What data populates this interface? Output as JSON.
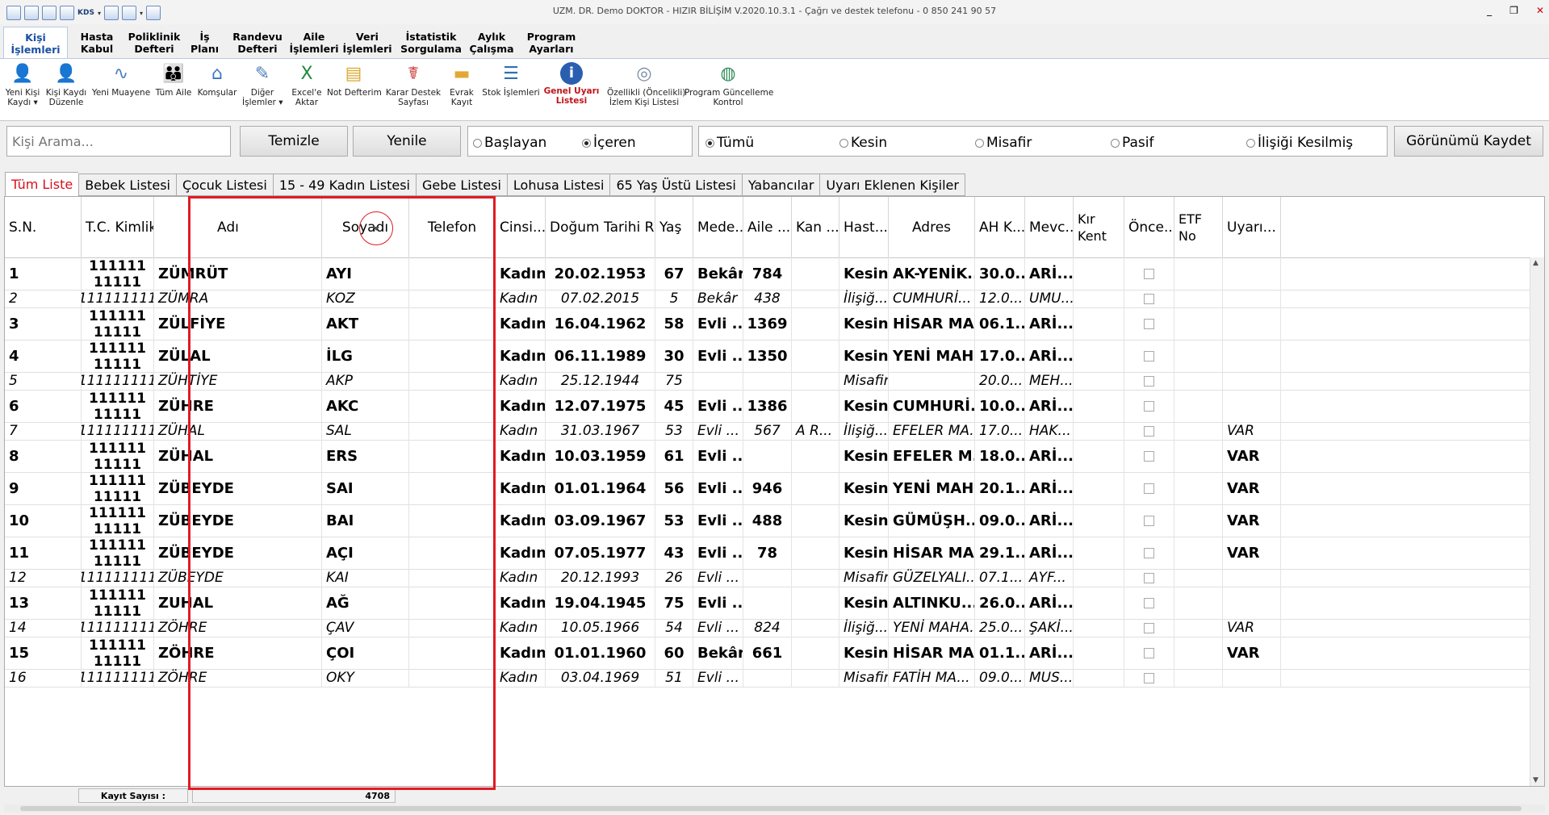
{
  "window": {
    "title": "UZM. DR. Demo DOKTOR - HIZIR BİLİŞİM V.2020.10.3.1 - Çağrı ve destek telefonu - 0 850 241 90 57",
    "quick_access_kds": "KDS",
    "minimize": "_",
    "restore": "❐",
    "close": "✕"
  },
  "ribbon_tabs": [
    "Kişi\nİşlemleri",
    "Hasta\nKabul",
    "Poliklinik\nDefteri",
    "İş\nPlanı",
    "Randevu\nDefteri",
    "Aile\nİşlemleri",
    "Veri\nİşlemleri",
    "İstatistik\nSorgulama",
    "Aylık\nÇalışma",
    "Program\nAyarları"
  ],
  "ribbon_buttons": [
    {
      "label": "Yeni Kişi\nKaydı ▾",
      "icon": "add-person-icon",
      "glyph": "👤",
      "color": "#4a8fd6"
    },
    {
      "label": "Kişi Kaydı\nDüzenle",
      "icon": "edit-person-icon",
      "glyph": "👤",
      "color": "#3d7fc9"
    },
    {
      "label": "Yeni Muayene",
      "icon": "stethoscope-icon",
      "glyph": "∿",
      "color": "#4a7fc0"
    },
    {
      "label": "Tüm Aile",
      "icon": "family-icon",
      "glyph": "👪",
      "color": "#d89b2a"
    },
    {
      "label": "Komşular",
      "icon": "house-icon",
      "glyph": "⌂",
      "color": "#3a76c4"
    },
    {
      "label": "Diğer\nİşlemler ▾",
      "icon": "other-actions-icon",
      "glyph": "✎",
      "color": "#4d7fb8"
    },
    {
      "label": "Excel'e\nAktar",
      "icon": "excel-icon",
      "glyph": "X",
      "color": "#1f8a3f"
    },
    {
      "label": "Not Defterim",
      "icon": "notepad-icon",
      "glyph": "▤",
      "color": "#d9a92f"
    },
    {
      "label": "Karar Destek\nSayfası",
      "icon": "decision-support-icon",
      "glyph": "☤",
      "color": "#c93838"
    },
    {
      "label": "Evrak\nKayıt",
      "icon": "folder-icon",
      "glyph": "▬",
      "color": "#e3a834"
    },
    {
      "label": "Stok İşlemleri",
      "icon": "stock-list-icon",
      "glyph": "☰",
      "color": "#2e6fb8"
    },
    {
      "label": "Genel Uyarı\nListesi",
      "icon": "info-icon",
      "glyph": "i",
      "color": "#2a5fb0"
    },
    {
      "label": "Özellikli (Öncelikli)\nİzlem Kişi Listesi",
      "icon": "priority-list-icon",
      "glyph": "◎",
      "color": "#7a8aa0"
    },
    {
      "label": "Program Güncelleme\nKontrol",
      "icon": "update-globe-icon",
      "glyph": "◍",
      "color": "#2e8b57"
    }
  ],
  "search": {
    "placeholder": "Kişi Arama..."
  },
  "buttons": {
    "clear": "Temizle",
    "refresh": "Yenile",
    "save_view": "Görünümü Kaydet"
  },
  "match_mode": {
    "starts": "Başlayan",
    "contains": "İçeren",
    "selected": "contains"
  },
  "status_filter": {
    "all": "Tümü",
    "definite": "Kesin",
    "guest": "Misafir",
    "passive": "Pasif",
    "detached": "İlişiği Kesilmiş",
    "selected": "all"
  },
  "list_tabs": [
    "Tüm Liste",
    "Bebek Listesi",
    "Çocuk Listesi",
    "15 - 49 Kadın Listesi",
    "Gebe Listesi",
    "Lohusa Listesi",
    "65 Yaş Üstü Listesi",
    "Yabancılar",
    "Uyarı Eklenen Kişiler"
  ],
  "columns": [
    "S.N.",
    "T.C. Kimlik No",
    "Adı",
    "Soyadı",
    "Telefon",
    "Cinsi...",
    "Doğum Tarihi R...",
    "Yaş",
    "Mede...",
    "Aile ...",
    "Kan ...",
    "Hast...",
    "Adres",
    "AH K...",
    "Mevc...",
    "Kır\nKent",
    "Önce...",
    "ETF\nNo",
    "Uyarı..."
  ],
  "rows": [
    {
      "sn": "1",
      "tc": "11111111111",
      "adi": "ZÜMRÜT",
      "soyadi": "AYI",
      "tel": "",
      "cins": "Kadın",
      "dogum": "20.02.1953",
      "yas": "67",
      "medeni": "Bekâr",
      "aile": "784",
      "kan": "",
      "hasta": "Kesin",
      "adres": "AK-YENİK...",
      "ah": "30.0...",
      "mevcut": "ARİ...",
      "uyari": "",
      "style": "b"
    },
    {
      "sn": "2",
      "tc": "11111111111",
      "adi": "ZÜMRA",
      "soyadi": "KOZ",
      "tel": "",
      "cins": "Kadın",
      "dogum": "07.02.2015",
      "yas": "5",
      "medeni": "Bekâr",
      "aile": "438",
      "kan": "",
      "hasta": "İlişiğ...",
      "adres": "CUMHURİ...",
      "ah": "12.0...",
      "mevcut": "UMU...",
      "uyari": "",
      "style": "i"
    },
    {
      "sn": "3",
      "tc": "11111111111",
      "adi": "ZÜLFİYE",
      "soyadi": "AKT",
      "tel": "",
      "cins": "Kadın",
      "dogum": "16.04.1962",
      "yas": "58",
      "medeni": "Evli ...",
      "aile": "1369",
      "kan": "",
      "hasta": "Kesin",
      "adres": "HİSAR MA...",
      "ah": "06.1...",
      "mevcut": "ARİ...",
      "uyari": "",
      "style": "b"
    },
    {
      "sn": "4",
      "tc": "11111111111",
      "adi": "ZÜLAL",
      "soyadi": "İLG",
      "tel": "",
      "cins": "Kadın",
      "dogum": "06.11.1989",
      "yas": "30",
      "medeni": "Evli ...",
      "aile": "1350",
      "kan": "",
      "hasta": "Kesin",
      "adres": "YENİ MAH...",
      "ah": "17.0...",
      "mevcut": "ARİ...",
      "uyari": "",
      "style": "b"
    },
    {
      "sn": "5",
      "tc": "11111111111",
      "adi": "ZÜHTİYE",
      "soyadi": "AKP",
      "tel": "",
      "cins": "Kadın",
      "dogum": "25.12.1944",
      "yas": "75",
      "medeni": "",
      "aile": "",
      "kan": "",
      "hasta": "Misafir",
      "adres": "",
      "ah": "20.0...",
      "mevcut": "MEH...",
      "uyari": "",
      "style": "i"
    },
    {
      "sn": "6",
      "tc": "11111111111",
      "adi": "ZÜHRE",
      "soyadi": "AKC",
      "tel": "",
      "cins": "Kadın",
      "dogum": "12.07.1975",
      "yas": "45",
      "medeni": "Evli ...",
      "aile": "1386",
      "kan": "",
      "hasta": "Kesin",
      "adres": "CUMHURİ...",
      "ah": "10.0...",
      "mevcut": "ARİ...",
      "uyari": "",
      "style": "b"
    },
    {
      "sn": "7",
      "tc": "11111111111",
      "adi": "ZÜHAL",
      "soyadi": "SAL",
      "tel": "",
      "cins": "Kadın",
      "dogum": "31.03.1967",
      "yas": "53",
      "medeni": "Evli ...",
      "aile": "567",
      "kan": "A R...",
      "hasta": "İlişiğ...",
      "adres": "EFELER MA...",
      "ah": "17.0...",
      "mevcut": "HAK...",
      "uyari": "VAR",
      "style": "i"
    },
    {
      "sn": "8",
      "tc": "11111111111",
      "adi": "ZÜHAL",
      "soyadi": "ERS",
      "tel": "",
      "cins": "Kadın",
      "dogum": "10.03.1959",
      "yas": "61",
      "medeni": "Evli ...",
      "aile": "",
      "kan": "",
      "hasta": "Kesin",
      "adres": "EFELER M...",
      "ah": "18.0...",
      "mevcut": "ARİ...",
      "uyari": "VAR",
      "style": "b"
    },
    {
      "sn": "9",
      "tc": "11111111111",
      "adi": "ZÜBEYDE",
      "soyadi": "SAI",
      "tel": "",
      "cins": "Kadın",
      "dogum": "01.01.1964",
      "yas": "56",
      "medeni": "Evli ...",
      "aile": "946",
      "kan": "",
      "hasta": "Kesin",
      "adres": "YENİ MAH...",
      "ah": "20.1...",
      "mevcut": "ARİ...",
      "uyari": "VAR",
      "style": "b"
    },
    {
      "sn": "10",
      "tc": "11111111111",
      "adi": "ZÜBEYDE",
      "soyadi": "BAI",
      "tel": "",
      "cins": "Kadın",
      "dogum": "03.09.1967",
      "yas": "53",
      "medeni": "Evli ...",
      "aile": "488",
      "kan": "",
      "hasta": "Kesin",
      "adres": "GÜMÜŞH...",
      "ah": "09.0...",
      "mevcut": "ARİ...",
      "uyari": "VAR",
      "style": "b"
    },
    {
      "sn": "11",
      "tc": "11111111111",
      "adi": "ZÜBEYDE",
      "soyadi": "AÇI",
      "tel": "",
      "cins": "Kadın",
      "dogum": "07.05.1977",
      "yas": "43",
      "medeni": "Evli ...",
      "aile": "78",
      "kan": "",
      "hasta": "Kesin",
      "adres": "HİSAR MA...",
      "ah": "29.1...",
      "mevcut": "ARİ...",
      "uyari": "VAR",
      "style": "b"
    },
    {
      "sn": "12",
      "tc": "11111111111",
      "adi": "ZÜBEYDE",
      "soyadi": "KAI",
      "tel": "",
      "cins": "Kadın",
      "dogum": "20.12.1993",
      "yas": "26",
      "medeni": "Evli ...",
      "aile": "",
      "kan": "",
      "hasta": "Misafir",
      "adres": "GÜZELYALI...",
      "ah": "07.1...",
      "mevcut": "AYF...",
      "uyari": "",
      "style": "i"
    },
    {
      "sn": "13",
      "tc": "11111111111",
      "adi": "ZUHAL",
      "soyadi": "AĞ",
      "tel": "",
      "cins": "Kadın",
      "dogum": "19.04.1945",
      "yas": "75",
      "medeni": "Evli ...",
      "aile": "",
      "kan": "",
      "hasta": "Kesin",
      "adres": "ALTINKU...",
      "ah": "26.0...",
      "mevcut": "ARİ...",
      "uyari": "",
      "style": "b"
    },
    {
      "sn": "14",
      "tc": "11111111111",
      "adi": "ZÖHRE",
      "soyadi": "ÇAV",
      "tel": "",
      "cins": "Kadın",
      "dogum": "10.05.1966",
      "yas": "54",
      "medeni": "Evli ...",
      "aile": "824",
      "kan": "",
      "hasta": "İlişiğ...",
      "adres": "YENİ MAHA...",
      "ah": "25.0...",
      "mevcut": "ŞAKİ...",
      "uyari": "VAR",
      "style": "i"
    },
    {
      "sn": "15",
      "tc": "11111111111",
      "adi": "ZÖHRE",
      "soyadi": "ÇOI",
      "tel": "",
      "cins": "Kadın",
      "dogum": "01.01.1960",
      "yas": "60",
      "medeni": "Bekâr",
      "aile": "661",
      "kan": "",
      "hasta": "Kesin",
      "adres": "HİSAR MA...",
      "ah": "01.1...",
      "mevcut": "ARİ...",
      "uyari": "VAR",
      "style": "b"
    },
    {
      "sn": "16",
      "tc": "11111111111",
      "adi": "ZÖHRE",
      "soyadi": "OKY",
      "tel": "",
      "cins": "Kadın",
      "dogum": "03.04.1969",
      "yas": "51",
      "medeni": "Evli ...",
      "aile": "",
      "kan": "",
      "hasta": "Misafir",
      "adres": "FATİH MA...",
      "ah": "09.0...",
      "mevcut": "MUS...",
      "uyari": "",
      "style": "i"
    }
  ],
  "footer": {
    "count_label": "Kayıt Sayısı :",
    "count_value": "4708"
  },
  "colors": {
    "accent_red": "#e01b24",
    "active_tab_text": "#d8101b",
    "ribbon_active": "#1a4fa3"
  }
}
